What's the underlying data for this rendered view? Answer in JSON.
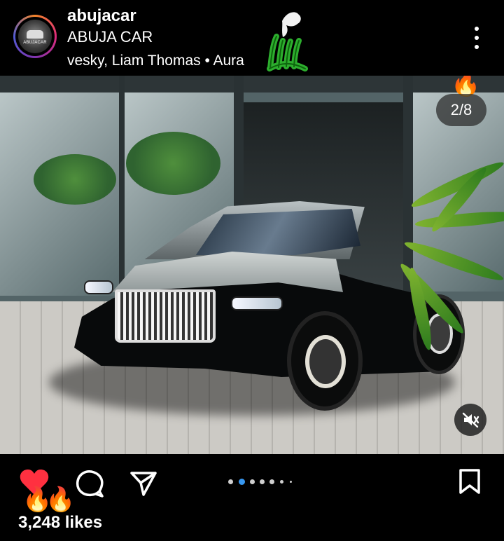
{
  "post": {
    "username": "abujacar",
    "subtitle": "ABUJA CAR",
    "audio": "vesky, Liam Thomas • Aura",
    "avatar_text": "ABUJACAR"
  },
  "media": {
    "counter": "2/8",
    "fire_emoji": "🔥"
  },
  "actions": {
    "fire_emoji": "🔥",
    "likes": "3,248 likes"
  },
  "icons": {
    "more": "more-horizontal-icon",
    "mute": "mute-icon",
    "heart": "heart-icon",
    "comment": "comment-icon",
    "share": "share-icon",
    "save": "save-icon"
  },
  "colors": {
    "background": "#000000",
    "heart": "#ff3040",
    "accent_dot": "#3797f0",
    "badge_green": "#2dae2e"
  }
}
